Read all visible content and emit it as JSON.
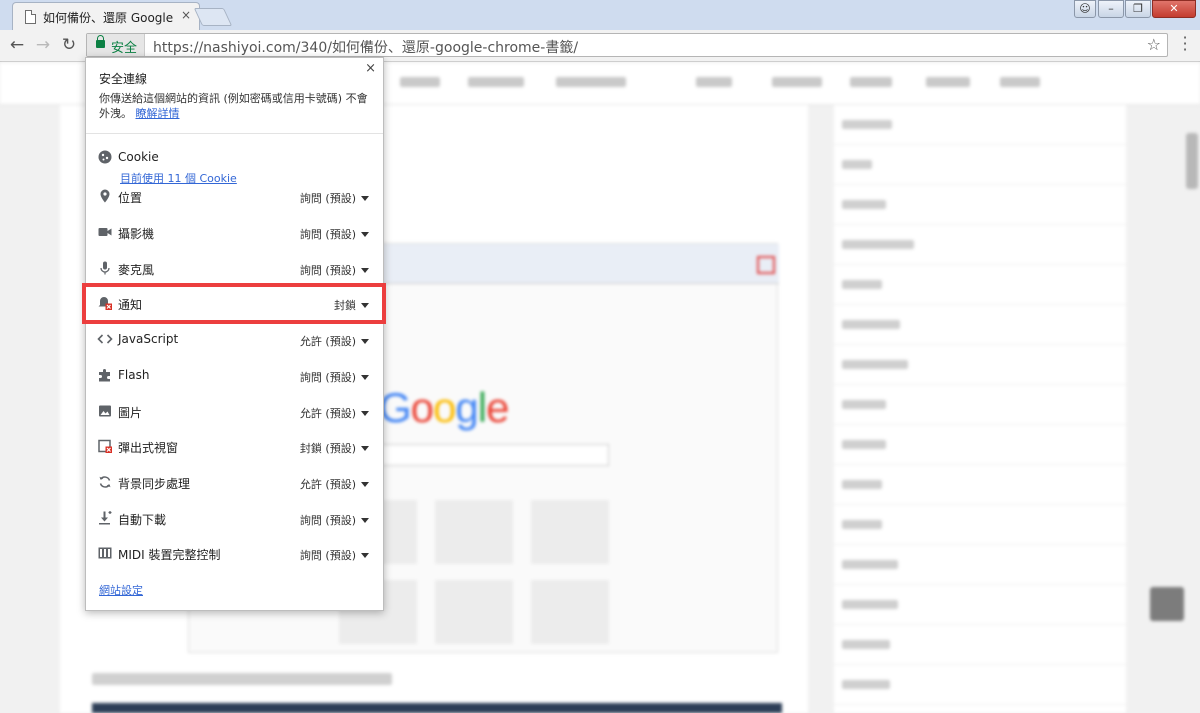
{
  "window": {
    "tab_title": "如何備份、還原 Google",
    "tab_close": "×"
  },
  "toolbar": {
    "back": "←",
    "forward": "→",
    "reload": "↻",
    "secure_label": "安全",
    "url": "https://nashiyoi.com/340/如何備份、還原-google-chrome-書籤/",
    "star": "☆"
  },
  "popup": {
    "close": "×",
    "title": "安全連線",
    "description": "你傳送給這個網站的資訊 (例如密碼或信用卡號碼) 不會外洩。",
    "learn_more": "瞭解詳情",
    "cookie_label": "Cookie",
    "cookie_link": "目前使用 11 個 Cookie",
    "permissions": [
      {
        "label": "位置",
        "value": "詢問 (預設)"
      },
      {
        "label": "攝影機",
        "value": "詢問 (預設)"
      },
      {
        "label": "麥克風",
        "value": "詢問 (預設)"
      },
      {
        "label": "通知",
        "value": "封鎖"
      },
      {
        "label": "JavaScript",
        "value": "允許 (預設)"
      },
      {
        "label": "Flash",
        "value": "詢問 (預設)"
      },
      {
        "label": "圖片",
        "value": "允許 (預設)"
      },
      {
        "label": "彈出式視窗",
        "value": "封鎖 (預設)"
      },
      {
        "label": "背景同步處理",
        "value": "允許 (預設)"
      },
      {
        "label": "自動下載",
        "value": "詢問 (預設)"
      },
      {
        "label": "MIDI 裝置完整控制",
        "value": "詢問 (預設)"
      }
    ],
    "site_settings": "網站設定"
  },
  "background": {
    "google_logo": "Google"
  },
  "colors": {
    "secure_green": "#0b8043",
    "link_blue": "#3367d6",
    "highlight_red": "#ec3e3e"
  }
}
